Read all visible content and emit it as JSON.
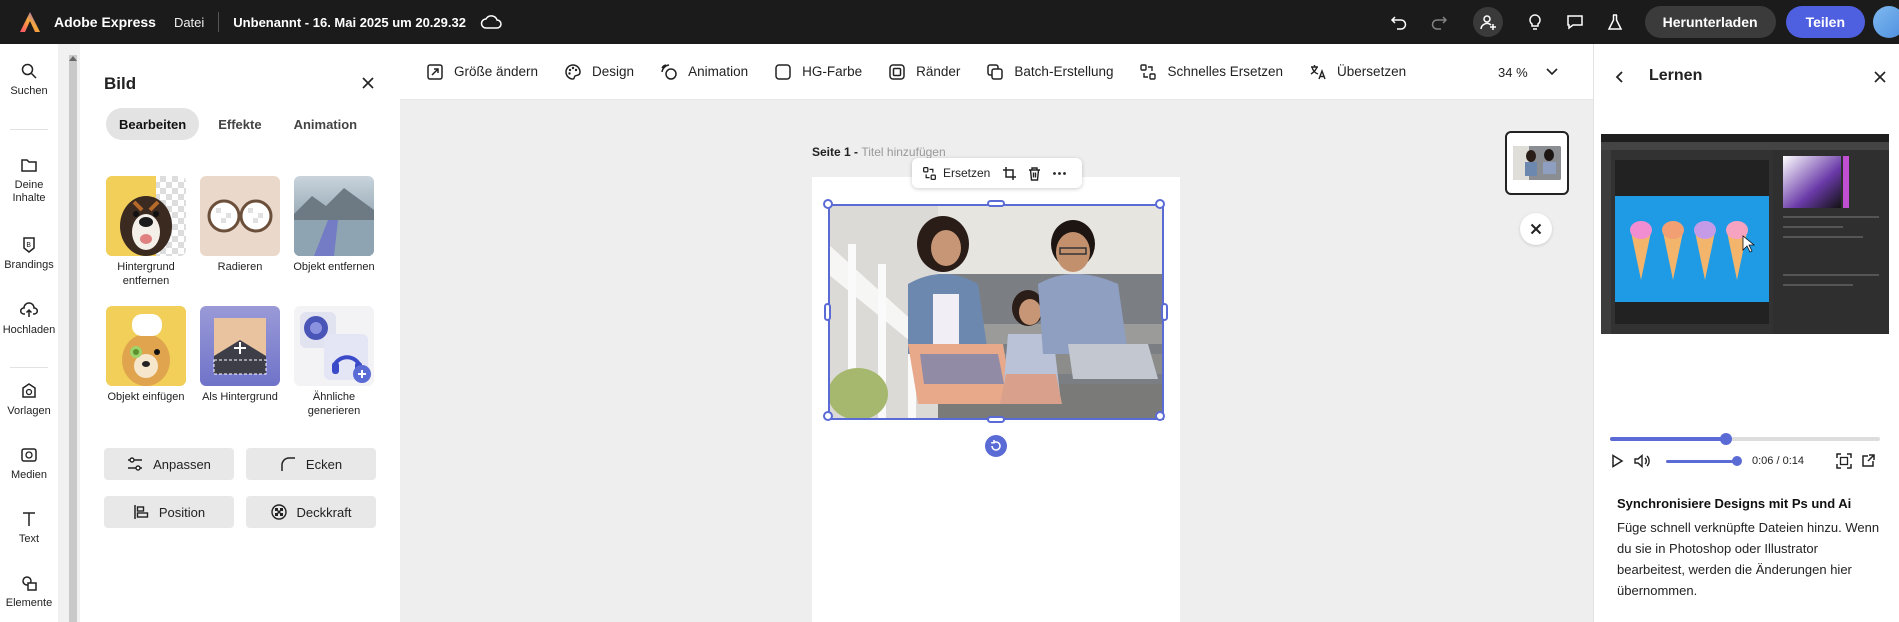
{
  "app": {
    "name": "Adobe Express",
    "file_menu": "Datei",
    "doc_title": "Unbenannt - 16. Mai 2025 um 20.29.32",
    "download_label": "Herunterladen",
    "share_label": "Teilen"
  },
  "colors": {
    "accent": "#5b6bd5",
    "share_button": "#4e5fe0",
    "topbar": "#1b1b1b"
  },
  "rail": {
    "items": [
      {
        "label": "Suchen",
        "icon": "search-icon"
      },
      {
        "label": "Deine Inhalte",
        "icon": "folder-icon"
      },
      {
        "label": "Brandings",
        "icon": "brand-icon"
      },
      {
        "label": "Hochladen",
        "icon": "upload-cloud-icon"
      },
      {
        "label": "Vorlagen",
        "icon": "templates-icon"
      },
      {
        "label": "Medien",
        "icon": "media-icon"
      },
      {
        "label": "Text",
        "icon": "text-icon"
      },
      {
        "label": "Elemente",
        "icon": "elements-icon"
      }
    ]
  },
  "panel": {
    "title": "Bild",
    "tabs": [
      "Bearbeiten",
      "Effekte",
      "Animation"
    ],
    "active_tab": "Bearbeiten",
    "tools": [
      {
        "label": "Hintergrund entfernen"
      },
      {
        "label": "Radieren"
      },
      {
        "label": "Objekt entfernen"
      },
      {
        "label": "Objekt einfügen"
      },
      {
        "label": "Als Hintergrund"
      },
      {
        "label": "Ähnliche generieren"
      }
    ],
    "actions": [
      {
        "label": "Anpassen"
      },
      {
        "label": "Ecken"
      },
      {
        "label": "Position"
      },
      {
        "label": "Deckkraft"
      }
    ]
  },
  "toolbar": {
    "items": [
      {
        "label": "Größe ändern"
      },
      {
        "label": "Design"
      },
      {
        "label": "Animation"
      },
      {
        "label": "HG-Farbe"
      },
      {
        "label": "Ränder"
      },
      {
        "label": "Batch-Erstellung"
      },
      {
        "label": "Schnelles Ersetzen"
      },
      {
        "label": "Übersetzen"
      }
    ],
    "zoom": "34 %"
  },
  "canvas": {
    "page_label": "Seite 1 - ",
    "page_title_placeholder": "Titel hinzufügen",
    "floatbar_replace": "Ersetzen"
  },
  "learn": {
    "title": "Lernen",
    "progress": 0.43,
    "time": "0:06 / 0:14",
    "heading": "Synchronisiere Designs mit Ps und Ai",
    "body": "Füge schnell verknüpfte Dateien hinzu. Wenn du sie in Photoshop oder Illustrator bearbeitest, werden die Änderungen hier übernommen."
  }
}
